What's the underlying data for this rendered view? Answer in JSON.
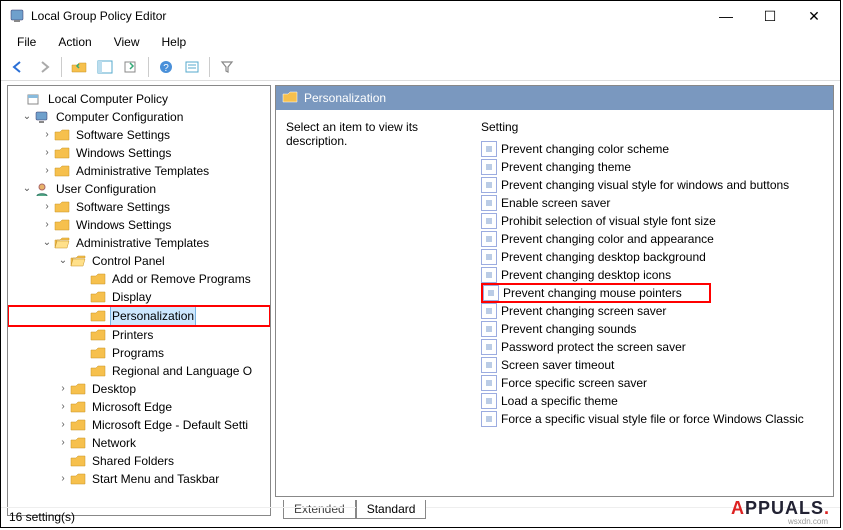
{
  "window": {
    "title": "Local Group Policy Editor",
    "min": "—",
    "max": "☐",
    "close": "✕"
  },
  "menu": {
    "file": "File",
    "action": "Action",
    "view": "View",
    "help": "Help"
  },
  "tree": {
    "root": "Local Computer Policy",
    "cc": "Computer Configuration",
    "cc_ss": "Software Settings",
    "cc_ws": "Windows Settings",
    "cc_at": "Administrative Templates",
    "uc": "User Configuration",
    "uc_ss": "Software Settings",
    "uc_ws": "Windows Settings",
    "uc_at": "Administrative Templates",
    "cp": "Control Panel",
    "cp_arp": "Add or Remove Programs",
    "cp_disp": "Display",
    "cp_pers": "Personalization",
    "cp_prn": "Printers",
    "cp_prog": "Programs",
    "cp_rlo": "Regional and Language O",
    "desktop": "Desktop",
    "me": "Microsoft Edge",
    "me_def": "Microsoft Edge - Default Setti",
    "network": "Network",
    "shf": "Shared Folders",
    "smt": "Start Menu and Taskbar"
  },
  "right": {
    "header": "Personalization",
    "desc": "Select an item to view its description.",
    "setting_hdr": "Setting",
    "items": [
      "Prevent changing color scheme",
      "Prevent changing theme",
      "Prevent changing visual style for windows and buttons",
      "Enable screen saver",
      "Prohibit selection of visual style font size",
      "Prevent changing color and appearance",
      "Prevent changing desktop background",
      "Prevent changing desktop icons",
      "Prevent changing mouse pointers",
      "Prevent changing screen saver",
      "Prevent changing sounds",
      "Password protect the screen saver",
      "Screen saver timeout",
      "Force specific screen saver",
      "Load a specific theme",
      "Force a specific visual style file or force Windows Classic"
    ],
    "tabs": {
      "extended": "Extended",
      "standard": "Standard"
    },
    "highlight_index": 8
  },
  "status": "16 setting(s)",
  "watermark": {
    "a": "A",
    "ppuals": "PPUALS",
    "sub": "wsxdn.com"
  }
}
